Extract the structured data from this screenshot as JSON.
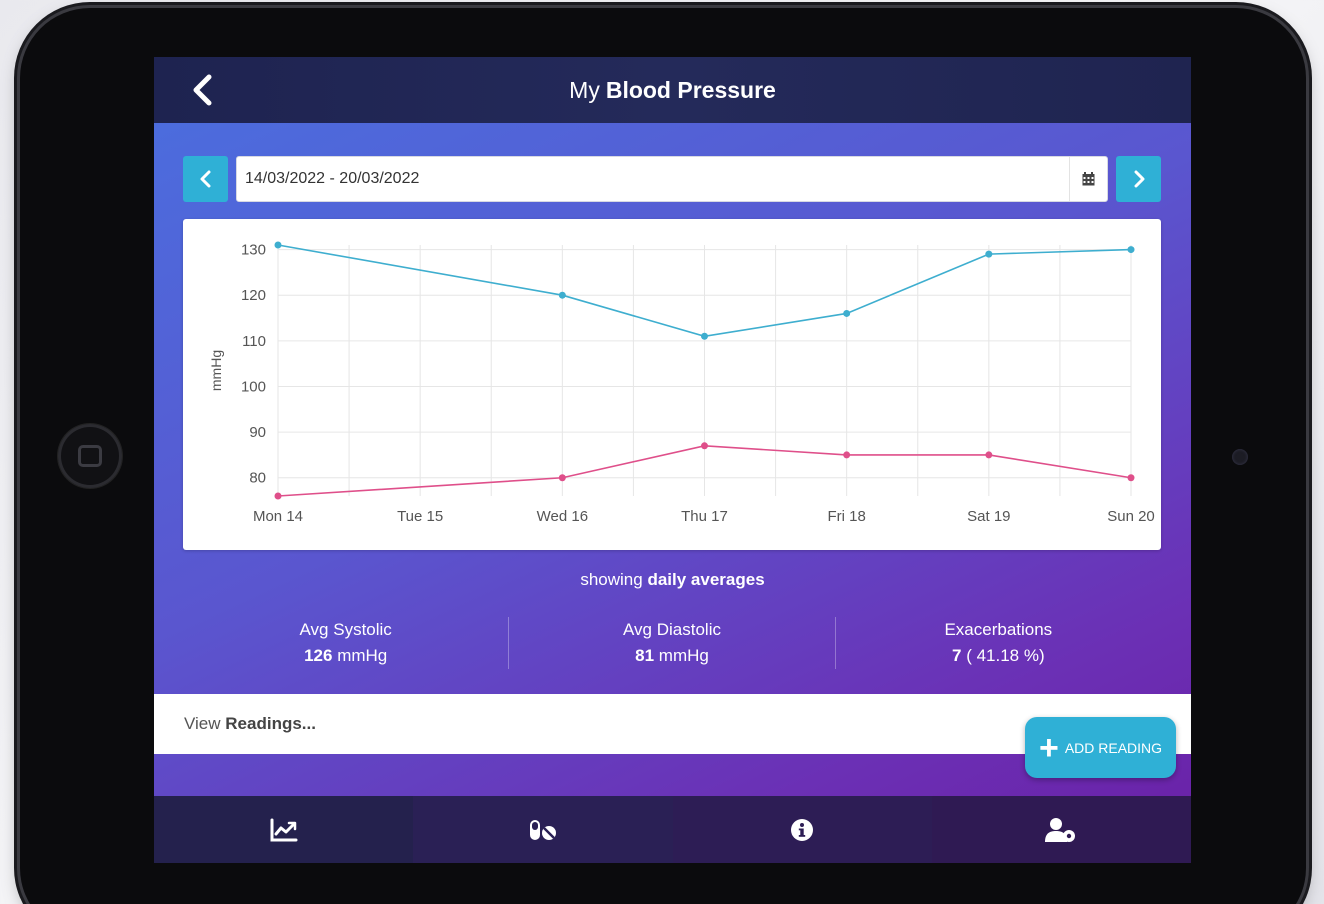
{
  "header": {
    "title_prefix": "My",
    "title_main": "Blood Pressure"
  },
  "date_range": {
    "value": "14/03/2022 - 20/03/2022"
  },
  "chart_data": {
    "type": "line",
    "categories": [
      "Mon 14",
      "Tue 15",
      "Wed 16",
      "Thu 17",
      "Fri 18",
      "Sat 19",
      "Sun 20"
    ],
    "x": [
      0,
      2,
      4,
      5,
      6
    ],
    "series": [
      {
        "color": "#3eaecf",
        "points": [
          [
            0,
            131
          ],
          [
            2,
            120
          ],
          [
            3,
            111
          ],
          [
            4,
            116
          ],
          [
            5,
            129
          ],
          [
            6,
            130
          ]
        ]
      },
      {
        "color": "#df4f8a",
        "points": [
          [
            0,
            76
          ],
          [
            2,
            80
          ],
          [
            3,
            87
          ],
          [
            4,
            85
          ],
          [
            5,
            85
          ],
          [
            6,
            80
          ]
        ]
      }
    ],
    "ylabel": "mmHg",
    "yticks": [
      80,
      90,
      100,
      110,
      120,
      130
    ],
    "ylim": [
      76,
      131
    ],
    "grid": true
  },
  "summary": {
    "showing_prefix": "showing",
    "showing_bold": "daily averages",
    "stats": [
      {
        "label": "Avg Systolic",
        "value": "126",
        "unit": "mmHg"
      },
      {
        "label": "Avg Diastolic",
        "value": "81",
        "unit": "mmHg"
      },
      {
        "label": "Exacerbations",
        "value": "7",
        "unit": "( 41.18 %)"
      }
    ]
  },
  "readings": {
    "prefix": "View",
    "bold": "Readings..."
  },
  "add_button": {
    "label": "ADD READING"
  },
  "nav": {
    "items": [
      {
        "icon": "chart-line-icon"
      },
      {
        "icon": "pills-icon"
      },
      {
        "icon": "info-circle-icon"
      },
      {
        "icon": "user-settings-icon"
      }
    ]
  }
}
